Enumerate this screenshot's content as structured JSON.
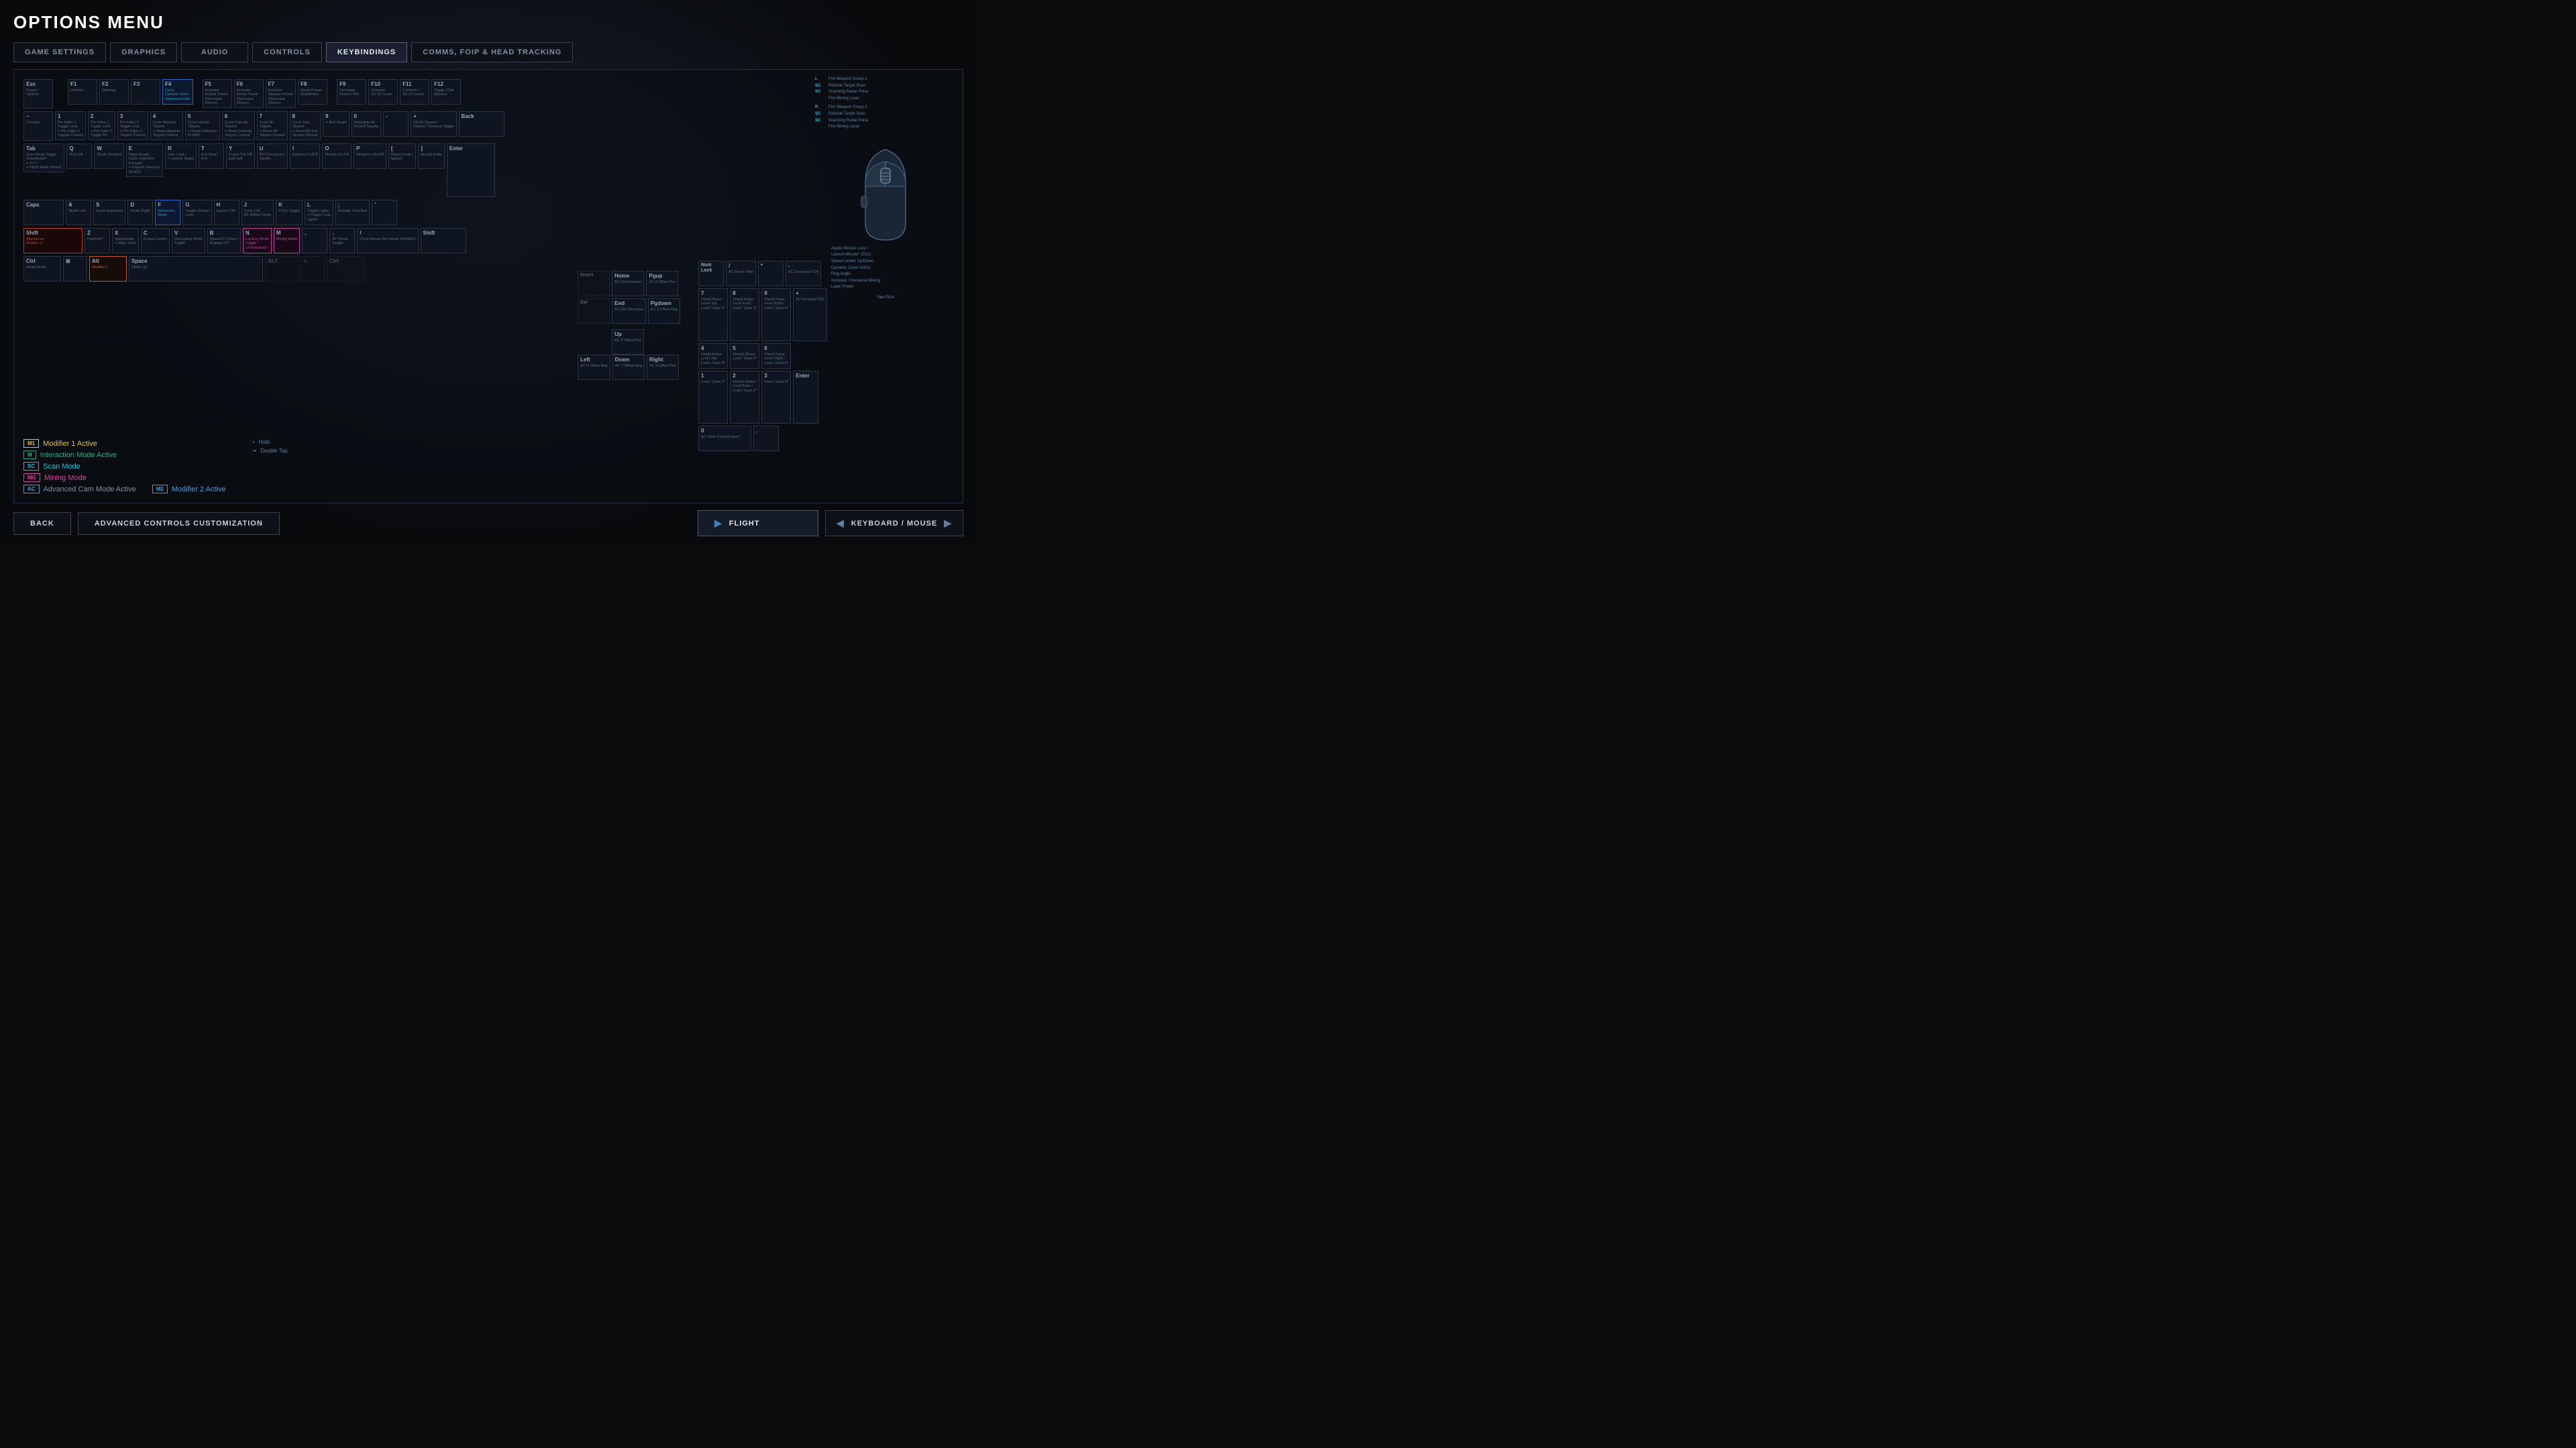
{
  "page": {
    "title": "OPTIONS MENU"
  },
  "nav": {
    "tabs": [
      {
        "id": "game-settings",
        "label": "GAME SETTINGS",
        "active": false
      },
      {
        "id": "graphics",
        "label": "GRAPHICS",
        "active": false
      },
      {
        "id": "audio",
        "label": "AUDIO",
        "active": false
      },
      {
        "id": "controls",
        "label": "CONTROLS",
        "active": false
      },
      {
        "id": "keybindings",
        "label": "KEYBINDINGS",
        "active": true
      },
      {
        "id": "comms",
        "label": "COMMS, FOIP & HEAD TRACKING",
        "active": false
      }
    ]
  },
  "keyboard": {
    "rows": {
      "function_row": {
        "keys": [
          {
            "label": "Esc",
            "binding": "Pause / Options"
          },
          {
            "label": "F1",
            "binding": "Hololize"
          },
          {
            "label": "F2",
            "binding": "Starmap"
          },
          {
            "label": "F3",
            "binding": ""
          },
          {
            "label": "F4",
            "binding": "Cycle Camera View / Advanced Cam",
            "highlight": "blue"
          },
          {
            "label": "F5",
            "binding": "Increase Engine Power (Decrease Others)"
          },
          {
            "label": "F6",
            "binding": "Increase Shield Power (Decrease Others)"
          },
          {
            "label": "F7",
            "binding": "Increase Weapon Power (Decrease Others)"
          },
          {
            "label": "F8",
            "binding": "Reset Power Distribution"
          },
          {
            "label": "F9",
            "binding": "Decrease Power / Min"
          },
          {
            "label": "F10",
            "binding": "Increase 2D UI Cursor"
          },
          {
            "label": "F11",
            "binding": "Contacts / 2D UI Cursor"
          },
          {
            "label": "F12",
            "binding": "Toggle Chat Window"
          }
        ]
      }
    }
  },
  "legend": {
    "items": [
      {
        "badge": "M1",
        "badge_class": "m1",
        "text": "Modifier 1 Active",
        "text_class": "m1-active"
      },
      {
        "badge": "M",
        "badge_class": "m",
        "text": "Interaction Mode Active",
        "text_class": "m-active"
      },
      {
        "badge": "SC",
        "badge_class": "sc",
        "text": "Scan Mode",
        "text_class": "sc-text"
      },
      {
        "badge": "MG",
        "badge_class": "mg",
        "text": "Mining Mode",
        "text_class": "mg-text"
      },
      {
        "badge": "AC",
        "badge_class": "ac",
        "text": "Advanced Cam Mode Active",
        "text_class": ""
      },
      {
        "badge": "M2",
        "badge_class": "ac",
        "text": "Modifier 2 Active",
        "text_class": "m2-active"
      }
    ],
    "symbols": [
      {
        "symbol": "•",
        "meaning": "Hold"
      },
      {
        "symbol": "••",
        "meaning": "Double Tap"
      }
    ]
  },
  "bottom": {
    "back_label": "BACK",
    "advanced_label": "ADVANCED CONTROLS CUSTOMIZATION",
    "flight_label": "FLIGHT",
    "keyboard_mouse_label": "Keyboard / Mouse"
  },
  "mouse": {
    "bindings": [
      {
        "key": "L",
        "action": "Fire Weapon Group 1"
      },
      {
        "key": "SC",
        "action": "Retickle Target Scan"
      },
      {
        "key": "SC",
        "action": "Scanning Radar Pulse"
      },
      {
        "key": "",
        "action": "Fire Mining Laser"
      },
      {
        "key": "R",
        "action": "Fire Weapon Group 2"
      },
      {
        "key": "SC",
        "action": "Retickle Target Scan"
      },
      {
        "key": "SC",
        "action": "Scanning Radar Pulse"
      },
      {
        "key": "",
        "action": "Fire Mining Laser"
      },
      {
        "key": "",
        "action": "Aspire Missile Lock / Launch Missile / CD(c)"
      },
      {
        "key": "",
        "action": "Speed Limiter Up/Down"
      },
      {
        "key": "",
        "action": "Dynamic Zoom In/Out"
      },
      {
        "key": "",
        "action": "Ping Angle"
      },
      {
        "key": "",
        "action": "Increase / Decrease Mining Laser Power"
      },
      {
        "key": "",
        "action": "Yaw Pitch"
      }
    ]
  }
}
